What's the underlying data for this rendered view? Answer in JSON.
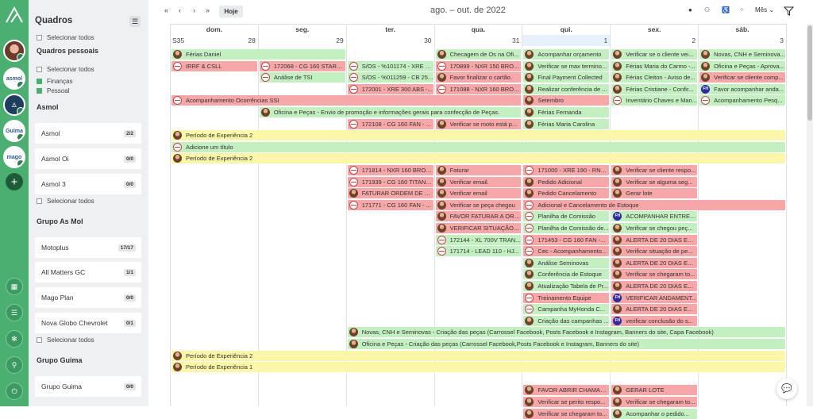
{
  "rail": {
    "logo": "triangle-logo-icon",
    "avatars": [
      {
        "name": "user-avatar-icon",
        "text": ""
      },
      {
        "name": "asmol-workspace-logo",
        "text": "asmol"
      },
      {
        "name": "asmol-triangle-logo",
        "text": ""
      },
      {
        "name": "guima-workspace-logo",
        "text": "Guima"
      },
      {
        "name": "mago-workspace-logo",
        "text": "mago"
      }
    ],
    "add": "+",
    "buttons": [
      {
        "name": "calendar-icon",
        "glyph": "▦"
      },
      {
        "name": "list-icon",
        "glyph": "☰"
      },
      {
        "name": "gear-icon",
        "glyph": "✻"
      },
      {
        "name": "search-icon",
        "glyph": "⚲"
      },
      {
        "name": "logout-icon",
        "glyph": "⏻"
      }
    ]
  },
  "sidebar": {
    "title": "Quadros",
    "select_all": "Selecionar todos",
    "personal_title": "Quadros pessoais",
    "personal_items": [
      "Finanças",
      "Pessoal"
    ],
    "groups": [
      {
        "title": "Asmol",
        "boards": [
          {
            "name": "Asmol",
            "count": "2/2"
          },
          {
            "name": "Asmol Oi",
            "count": "0/0"
          },
          {
            "name": "Asmol 3",
            "count": "0/0"
          }
        ]
      },
      {
        "title": "Grupo As Mol",
        "boards": [
          {
            "name": "Motoplus",
            "count": "17/17"
          },
          {
            "name": "All Matters GC",
            "count": "1/1"
          },
          {
            "name": "Mago Plan",
            "count": "0/0"
          },
          {
            "name": "Nova Globo Chevrolet",
            "count": "0/1"
          }
        ]
      },
      {
        "title": "Grupo Guima",
        "boards": [
          {
            "name": "Grupo Guima",
            "count": "0/0"
          }
        ]
      }
    ]
  },
  "toolbar": {
    "first": "«",
    "prev": "‹",
    "next": "›",
    "last": "»",
    "today": "Hoje",
    "title": "ago. – out. de 2022",
    "view": "Mês",
    "view_caret": "⌄"
  },
  "calendar": {
    "days": [
      "dom.",
      "seg.",
      "ter.",
      "qua.",
      "qui.",
      "sex.",
      "sáb."
    ],
    "week_label": "S35",
    "dates": [
      "28",
      "29",
      "30",
      "31",
      "1",
      "2",
      "3"
    ],
    "today_index": 4,
    "events": [
      {
        "c": 0,
        "s": 2,
        "row": 0,
        "col": "g",
        "ic": "p",
        "t": "Férias Daniel"
      },
      {
        "c": 3,
        "s": 1,
        "row": 0,
        "col": "g",
        "ic": "p",
        "t": "Checagem de Os na Ofi..."
      },
      {
        "c": 4,
        "s": 1,
        "row": 0,
        "col": "g",
        "ic": "p",
        "t": "Acompanhar orçamento"
      },
      {
        "c": 5,
        "s": 1,
        "row": 0,
        "col": "g",
        "ic": "p",
        "t": "Verificar se o cliente vei..."
      },
      {
        "c": 6,
        "s": 1,
        "row": 0,
        "col": "g",
        "ic": "p",
        "t": "Novas, CNH e Seminova..."
      },
      {
        "c": 0,
        "s": 1,
        "row": 1,
        "col": "r",
        "ic": "m",
        "t": "IRRF & CSLL"
      },
      {
        "c": 1,
        "s": 1,
        "row": 1,
        "col": "r",
        "ic": "m",
        "t": "172068 - CG 160 START ..."
      },
      {
        "c": 2,
        "s": 1,
        "row": 1,
        "col": "g",
        "ic": "m",
        "t": "S/OS - %101174 - XRE 3..."
      },
      {
        "c": 3,
        "s": 1,
        "row": 1,
        "col": "r",
        "ic": "m",
        "t": "170899 - NXR 150 BROS..."
      },
      {
        "c": 4,
        "s": 1,
        "row": 1,
        "col": "g",
        "ic": "p",
        "t": "Verificar se max termino..."
      },
      {
        "c": 5,
        "s": 1,
        "row": 1,
        "col": "g",
        "ic": "p",
        "t": "Férias Maria do Carmo -..."
      },
      {
        "c": 6,
        "s": 1,
        "row": 1,
        "col": "g",
        "ic": "p",
        "t": "Oficina e Peças - Aprova..."
      },
      {
        "c": 1,
        "s": 1,
        "row": 2,
        "col": "g",
        "ic": "m",
        "t": "Análise de TSI"
      },
      {
        "c": 2,
        "s": 1,
        "row": 2,
        "col": "g",
        "ic": "m",
        "t": "S/OS - %011259 - CB 25..."
      },
      {
        "c": 3,
        "s": 1,
        "row": 2,
        "col": "r",
        "ic": "p",
        "t": "Favor finalizar o cartão."
      },
      {
        "c": 4,
        "s": 1,
        "row": 2,
        "col": "g",
        "ic": "p",
        "t": "Final Payment Collected"
      },
      {
        "c": 5,
        "s": 1,
        "row": 2,
        "col": "g",
        "ic": "p",
        "t": "Férias Cleiton - Aviso de..."
      },
      {
        "c": 6,
        "s": 1,
        "row": 2,
        "col": "r",
        "ic": "p",
        "t": "Verificar se cliente comp..."
      },
      {
        "c": 2,
        "s": 1,
        "row": 3,
        "col": "r",
        "ic": "m",
        "t": "172001 - XRE 300 ABS -..."
      },
      {
        "c": 3,
        "s": 1,
        "row": 3,
        "col": "r",
        "ic": "m",
        "t": "171088 - NXR 160 BROS..."
      },
      {
        "c": 4,
        "s": 1,
        "row": 3,
        "col": "g",
        "ic": "p",
        "t": "Realizar conferência de ..."
      },
      {
        "c": 5,
        "s": 1,
        "row": 3,
        "col": "g",
        "ic": "p",
        "t": "Férias Cristiane - Confir..."
      },
      {
        "c": 6,
        "s": 1,
        "row": 3,
        "col": "g",
        "ic": "fh",
        "t": "Favor acompanhar anda..."
      },
      {
        "c": 0,
        "s": 4,
        "row": 4,
        "col": "r",
        "ic": "m",
        "t": "Acompanhamento Ocorrências SSI"
      },
      {
        "c": 4,
        "s": 1,
        "row": 4,
        "col": "r",
        "ic": "p",
        "t": "Setembro"
      },
      {
        "c": 5,
        "s": 1,
        "row": 4,
        "col": "g",
        "ic": "m",
        "t": "Inventário Chaves e Man..."
      },
      {
        "c": 6,
        "s": 1,
        "row": 4,
        "col": "g",
        "ic": "m",
        "t": "Acompanhamento Pesq..."
      },
      {
        "c": 1,
        "s": 3,
        "row": 5,
        "col": "g",
        "ic": "p",
        "t": "Oficina e Peças - Envio de promoção e informações gerais para confecção de Peças."
      },
      {
        "c": 4,
        "s": 1,
        "row": 5,
        "col": "g",
        "ic": "p",
        "t": "Férias Fernanda"
      },
      {
        "c": 2,
        "s": 1,
        "row": 6,
        "col": "r",
        "ic": "m",
        "t": "172108 - CG 160 FAN - ..."
      },
      {
        "c": 3,
        "s": 1,
        "row": 6,
        "col": "r",
        "ic": "p",
        "t": "Verificar se moto está p..."
      },
      {
        "c": 4,
        "s": 1,
        "row": 6,
        "col": "g",
        "ic": "p",
        "t": "Férias Maria Carolina"
      },
      {
        "c": 0,
        "s": 7,
        "row": 7,
        "col": "y",
        "ic": "p",
        "t": "Período de Experiência 2"
      },
      {
        "c": 0,
        "s": 7,
        "row": 8,
        "col": "g",
        "ic": "m",
        "t": "Adicione um título"
      },
      {
        "c": 0,
        "s": 7,
        "row": 9,
        "col": "y",
        "ic": "p",
        "t": "Período de Experiência 2"
      },
      {
        "c": 2,
        "s": 1,
        "row": 10,
        "col": "r",
        "ic": "m",
        "t": "171814 - NXR 160 BROS..."
      },
      {
        "c": 3,
        "s": 1,
        "row": 10,
        "col": "r",
        "ic": "p",
        "t": "Faturar"
      },
      {
        "c": 4,
        "s": 1,
        "row": 10,
        "col": "r",
        "ic": "m",
        "t": "171000 - XRE 190 - RNJ-..."
      },
      {
        "c": 5,
        "s": 1,
        "row": 10,
        "col": "r",
        "ic": "p",
        "t": "Verificar se cliente respo..."
      },
      {
        "c": 2,
        "s": 1,
        "row": 11,
        "col": "r",
        "ic": "m",
        "t": "171939 - CG 160 TITAN -..."
      },
      {
        "c": 3,
        "s": 1,
        "row": 11,
        "col": "r",
        "ic": "p",
        "t": "Verificar email."
      },
      {
        "c": 4,
        "s": 1,
        "row": 11,
        "col": "r",
        "ic": "p",
        "t": "Pedido Adicional"
      },
      {
        "c": 5,
        "s": 1,
        "row": 11,
        "col": "r",
        "ic": "p",
        "t": "Verificar se alguma seg..."
      },
      {
        "c": 2,
        "s": 1,
        "row": 12,
        "col": "r",
        "ic": "p",
        "t": "FATURAR ORDEM DE SE..."
      },
      {
        "c": 3,
        "s": 1,
        "row": 12,
        "col": "r",
        "ic": "p",
        "t": "Verificar email"
      },
      {
        "c": 4,
        "s": 1,
        "row": 12,
        "col": "r",
        "ic": "p",
        "t": "Pedido Cancelamento"
      },
      {
        "c": 5,
        "s": 1,
        "row": 12,
        "col": "r",
        "ic": "p",
        "t": "Gerar lote"
      },
      {
        "c": 2,
        "s": 1,
        "row": 13,
        "col": "r",
        "ic": "m",
        "t": "171771 - CG 160 FAN - ..."
      },
      {
        "c": 3,
        "s": 1,
        "row": 13,
        "col": "r",
        "ic": "p",
        "t": "Verificar se peça chegou"
      },
      {
        "c": 4,
        "s": 3,
        "row": 13,
        "col": "r",
        "ic": "m",
        "t": "Adicional e Cancelamento de Estoque"
      },
      {
        "c": 3,
        "s": 1,
        "row": 14,
        "col": "r",
        "ic": "p",
        "t": "FAVOR FATURAR A ORD..."
      },
      {
        "c": 4,
        "s": 1,
        "row": 14,
        "col": "g",
        "ic": "m",
        "t": "Planilha de Comissão"
      },
      {
        "c": 5,
        "s": 1,
        "row": 14,
        "col": "g",
        "ic": "fh",
        "t": "ACOMPANHAR ENTREG..."
      },
      {
        "c": 3,
        "s": 1,
        "row": 15,
        "col": "r",
        "ic": "p",
        "t": "VERIFICAR SITUAÇÃO D..."
      },
      {
        "c": 4,
        "s": 1,
        "row": 15,
        "col": "g",
        "ic": "m",
        "t": "Planilha de Comissão de..."
      },
      {
        "c": 5,
        "s": 1,
        "row": 15,
        "col": "g",
        "ic": "p",
        "t": "Verificar se chegou peç..."
      },
      {
        "c": 3,
        "s": 1,
        "row": 16,
        "col": "g",
        "ic": "m",
        "t": "172144 - XL 700V TRAN..."
      },
      {
        "c": 4,
        "s": 1,
        "row": 16,
        "col": "r",
        "ic": "m",
        "t": "171453 - CG 160 FAN -..."
      },
      {
        "c": 5,
        "s": 1,
        "row": 16,
        "col": "r",
        "ic": "p",
        "t": "ALERTA DE 20 DIAS EM ..."
      },
      {
        "c": 3,
        "s": 1,
        "row": 17,
        "col": "g",
        "ic": "m",
        "t": "171714 - LEAD 110 - HJ..."
      },
      {
        "c": 4,
        "s": 1,
        "row": 17,
        "col": "r",
        "ic": "m",
        "t": "Cec - Acompanhamento..."
      },
      {
        "c": 5,
        "s": 1,
        "row": 17,
        "col": "r",
        "ic": "p",
        "t": "Verificar situação de pe..."
      },
      {
        "c": 4,
        "s": 1,
        "row": 18,
        "col": "g",
        "ic": "p",
        "t": "Análise Seminovas"
      },
      {
        "c": 5,
        "s": 1,
        "row": 18,
        "col": "r",
        "ic": "p",
        "t": "ALERTA DE 20 DIAS EM ..."
      },
      {
        "c": 4,
        "s": 1,
        "row": 19,
        "col": "g",
        "ic": "p",
        "t": "Conferência de Estoque"
      },
      {
        "c": 5,
        "s": 1,
        "row": 19,
        "col": "r",
        "ic": "p",
        "t": "Verificar se chegaram to..."
      },
      {
        "c": 4,
        "s": 1,
        "row": 20,
        "col": "g",
        "ic": "p",
        "t": "Atualização Tabela de Pr..."
      },
      {
        "c": 5,
        "s": 1,
        "row": 20,
        "col": "r",
        "ic": "p",
        "t": "ALERTA DE 20 DIAS EM ..."
      },
      {
        "c": 4,
        "s": 1,
        "row": 21,
        "col": "r",
        "ic": "m",
        "t": "Treinamento Equipe"
      },
      {
        "c": 5,
        "s": 1,
        "row": 21,
        "col": "r",
        "ic": "fh",
        "t": "VERIFICAR ANDAMENT..."
      },
      {
        "c": 4,
        "s": 1,
        "row": 22,
        "col": "g",
        "ic": "m",
        "t": "Campanha MyHonda C..."
      },
      {
        "c": 5,
        "s": 1,
        "row": 22,
        "col": "r",
        "ic": "p",
        "t": "ALERTA DE 20 DIAS EM ..."
      },
      {
        "c": 4,
        "s": 1,
        "row": 23,
        "col": "g",
        "ic": "p",
        "t": "Criação das campanhas ..."
      },
      {
        "c": 5,
        "s": 1,
        "row": 23,
        "col": "r",
        "ic": "fh",
        "t": "verificar conclusão do s..."
      },
      {
        "c": 2,
        "s": 5,
        "row": 24,
        "col": "g",
        "ic": "p",
        "t": "Novas, CNH e Seminovas - Criação das peças (Carrossel Facebook, Posts Facebook e Instagram, Banners do site, Capa Facebook)"
      },
      {
        "c": 2,
        "s": 5,
        "row": 25,
        "col": "g",
        "ic": "p",
        "t": "Oficina e Peças - Criação das peças (Carrossel Facebook,Posts Facebook e Instagram, Banners do site)"
      },
      {
        "c": 0,
        "s": 7,
        "row": 26,
        "col": "y",
        "ic": "p",
        "t": "Período de Experiência 2"
      },
      {
        "c": 0,
        "s": 7,
        "row": 27,
        "col": "y",
        "ic": "p",
        "t": "Período de Experiência 1"
      },
      {
        "c": 4,
        "s": 1,
        "row": 29,
        "col": "r",
        "ic": "p",
        "t": "FAVOR ABRIR CHAMAD..."
      },
      {
        "c": 5,
        "s": 1,
        "row": 29,
        "col": "r",
        "ic": "p",
        "t": "GERAR LOTE"
      },
      {
        "c": 4,
        "s": 1,
        "row": 30,
        "col": "r",
        "ic": "p",
        "t": "Verificar se perito respo..."
      },
      {
        "c": 5,
        "s": 1,
        "row": 30,
        "col": "r",
        "ic": "p",
        "t": "Verificar se chegaram to..."
      },
      {
        "c": 4,
        "s": 1,
        "row": 31,
        "col": "r",
        "ic": "p",
        "t": "Verificar se chegaram to..."
      },
      {
        "c": 5,
        "s": 1,
        "row": 31,
        "col": "g",
        "ic": "p",
        "t": "Acompanhar o pedido..."
      }
    ]
  },
  "icons": {
    "user": "user-icon",
    "users": "users-icon",
    "accessibility": "accessibility-icon",
    "dots": "dots-icon",
    "filter": "filter-icon",
    "chat": "chat-icon"
  },
  "colors": {
    "green": "#c3f0c0",
    "red": "#f7a7a7",
    "yellow": "#fbf7a8",
    "rail": "#4caf72"
  }
}
